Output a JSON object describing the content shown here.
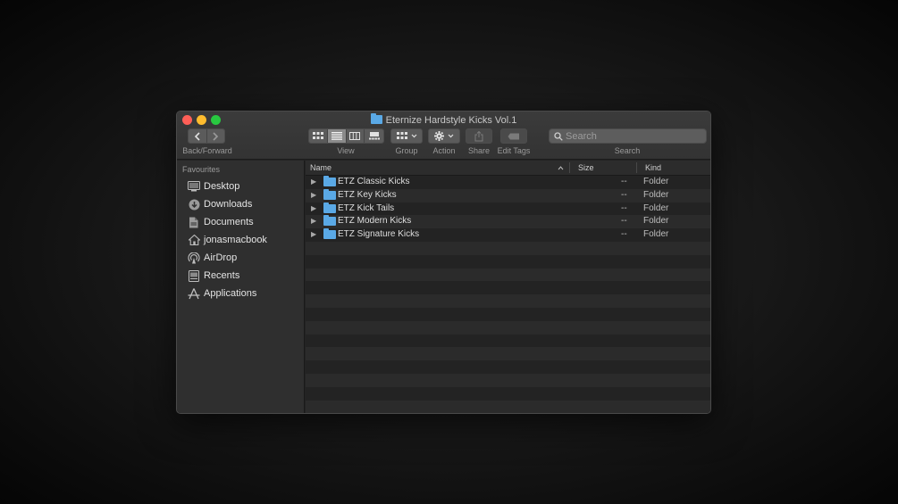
{
  "window": {
    "title": "Eternize Hardstyle Kicks Vol.1"
  },
  "toolbar": {
    "back_forward_label": "Back/Forward",
    "view_label": "View",
    "group_label": "Group",
    "action_label": "Action",
    "share_label": "Share",
    "edit_tags_label": "Edit Tags",
    "search_label": "Search",
    "search_placeholder": "Search"
  },
  "sidebar": {
    "heading": "Favourites",
    "items": [
      {
        "label": "Desktop",
        "icon": "desktop-icon"
      },
      {
        "label": "Downloads",
        "icon": "downloads-icon"
      },
      {
        "label": "Documents",
        "icon": "documents-icon"
      },
      {
        "label": "jonasmacbook",
        "icon": "home-icon"
      },
      {
        "label": "AirDrop",
        "icon": "airdrop-icon"
      },
      {
        "label": "Recents",
        "icon": "recents-icon"
      },
      {
        "label": "Applications",
        "icon": "applications-icon"
      }
    ]
  },
  "columns": {
    "name": "Name",
    "size": "Size",
    "kind": "Kind"
  },
  "files": [
    {
      "name": "ETZ Classic Kicks",
      "size": "--",
      "kind": "Folder"
    },
    {
      "name": "ETZ Key Kicks",
      "size": "--",
      "kind": "Folder"
    },
    {
      "name": "ETZ Kick Tails",
      "size": "--",
      "kind": "Folder"
    },
    {
      "name": "ETZ Modern Kicks",
      "size": "--",
      "kind": "Folder"
    },
    {
      "name": "ETZ Signature Kicks",
      "size": "--",
      "kind": "Folder"
    }
  ],
  "colors": {
    "folder": "#5aa9e6",
    "close": "#fe5f57",
    "minimize": "#febc2e",
    "maximize": "#28c840"
  }
}
